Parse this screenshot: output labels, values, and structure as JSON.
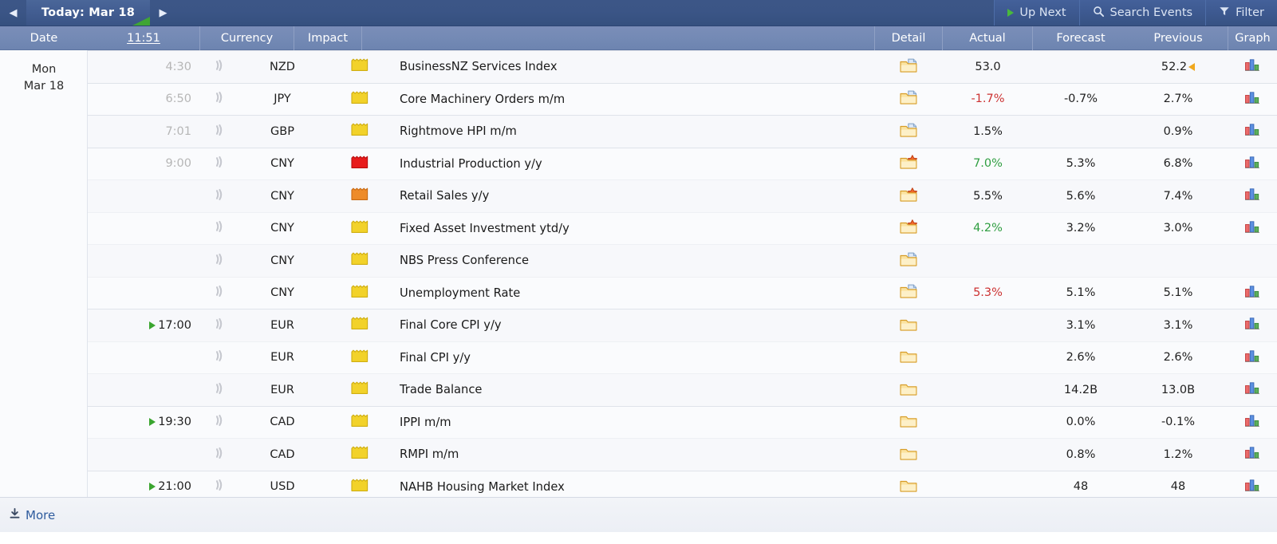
{
  "topbar": {
    "prev_icon": "chevron-left-icon",
    "next_icon": "chevron-right-icon",
    "date_tab": "Today: Mar 18",
    "up_next": "Up Next",
    "search_events": "Search Events",
    "filter": "Filter",
    "accent_green": "#3fa535",
    "bar_color": "#3b5586"
  },
  "columns": {
    "date": "Date",
    "time": "11:51",
    "currency": "Currency",
    "impact": "Impact",
    "event": "",
    "detail": "Detail",
    "actual": "Actual",
    "forecast": "Forecast",
    "previous": "Previous",
    "graph": "Graph"
  },
  "date_group": {
    "weekday": "Mon",
    "monthday": "Mar 18"
  },
  "colors": {
    "better": "#2f9e41",
    "worse": "#cc3232",
    "neutral": "#1f1f1f",
    "revision": "#f0a81e",
    "impact_high": "#e81c1c",
    "impact_medium": "#ee8b29",
    "impact_low": "#f2d22a"
  },
  "rows": [
    {
      "time": "4:30",
      "time_state": "past",
      "show_time": true,
      "group_start": true,
      "alarm": "alarm-icon",
      "currency": "NZD",
      "impact": "low",
      "event": "BusinessNZ Services Index",
      "detail": "folder-doc-icon",
      "actual": "53.0",
      "actual_state": "neutral",
      "forecast": "",
      "previous": "52.2",
      "previous_revised": true,
      "graph": "bar-chart-icon"
    },
    {
      "time": "6:50",
      "time_state": "past",
      "show_time": true,
      "group_start": true,
      "alarm": "alarm-icon",
      "currency": "JPY",
      "impact": "low",
      "event": "Core Machinery Orders m/m",
      "detail": "folder-doc-icon",
      "actual": "-1.7%",
      "actual_state": "worse",
      "forecast": "-0.7%",
      "previous": "2.7%",
      "previous_revised": false,
      "graph": "bar-chart-icon"
    },
    {
      "time": "7:01",
      "time_state": "past",
      "show_time": true,
      "group_start": true,
      "alarm": "alarm-icon",
      "currency": "GBP",
      "impact": "low",
      "event": "Rightmove HPI m/m",
      "detail": "folder-doc-icon",
      "actual": "1.5%",
      "actual_state": "neutral",
      "forecast": "",
      "previous": "0.9%",
      "previous_revised": false,
      "graph": "bar-chart-icon"
    },
    {
      "time": "9:00",
      "time_state": "past",
      "show_time": true,
      "group_start": true,
      "alarm": "alarm-icon",
      "currency": "CNY",
      "impact": "high",
      "event": "Industrial Production y/y",
      "detail": "folder-star-icon",
      "actual": "7.0%",
      "actual_state": "better",
      "forecast": "5.3%",
      "previous": "6.8%",
      "previous_revised": false,
      "graph": "bar-chart-icon"
    },
    {
      "time": "",
      "time_state": "past",
      "show_time": false,
      "group_start": false,
      "alarm": "alarm-icon",
      "currency": "CNY",
      "impact": "medium",
      "event": "Retail Sales y/y",
      "detail": "folder-star-icon",
      "actual": "5.5%",
      "actual_state": "neutral",
      "forecast": "5.6%",
      "previous": "7.4%",
      "previous_revised": false,
      "graph": "bar-chart-icon"
    },
    {
      "time": "",
      "time_state": "past",
      "show_time": false,
      "group_start": false,
      "alarm": "alarm-icon",
      "currency": "CNY",
      "impact": "low",
      "event": "Fixed Asset Investment ytd/y",
      "detail": "folder-star-icon",
      "actual": "4.2%",
      "actual_state": "better",
      "forecast": "3.2%",
      "previous": "3.0%",
      "previous_revised": false,
      "graph": "bar-chart-icon"
    },
    {
      "time": "",
      "time_state": "past",
      "show_time": false,
      "group_start": false,
      "alarm": "alarm-icon",
      "currency": "CNY",
      "impact": "low",
      "event": "NBS Press Conference",
      "detail": "folder-doc-icon",
      "actual": "",
      "actual_state": "neutral",
      "forecast": "",
      "previous": "",
      "previous_revised": false,
      "graph": ""
    },
    {
      "time": "",
      "time_state": "past",
      "show_time": false,
      "group_start": false,
      "alarm": "alarm-icon",
      "currency": "CNY",
      "impact": "low",
      "event": "Unemployment Rate",
      "detail": "folder-doc-icon",
      "actual": "5.3%",
      "actual_state": "worse",
      "forecast": "5.1%",
      "previous": "5.1%",
      "previous_revised": false,
      "graph": "bar-chart-icon"
    },
    {
      "time": "17:00",
      "time_state": "upcoming",
      "show_time": true,
      "group_start": true,
      "alarm": "alarm-icon",
      "currency": "EUR",
      "impact": "low",
      "event": "Final Core CPI y/y",
      "detail": "folder-icon",
      "actual": "",
      "actual_state": "neutral",
      "forecast": "3.1%",
      "previous": "3.1%",
      "previous_revised": false,
      "graph": "bar-chart-icon"
    },
    {
      "time": "",
      "time_state": "upcoming",
      "show_time": false,
      "group_start": false,
      "alarm": "alarm-icon",
      "currency": "EUR",
      "impact": "low",
      "event": "Final CPI y/y",
      "detail": "folder-icon",
      "actual": "",
      "actual_state": "neutral",
      "forecast": "2.6%",
      "previous": "2.6%",
      "previous_revised": false,
      "graph": "bar-chart-icon"
    },
    {
      "time": "",
      "time_state": "upcoming",
      "show_time": false,
      "group_start": false,
      "alarm": "alarm-icon",
      "currency": "EUR",
      "impact": "low",
      "event": "Trade Balance",
      "detail": "folder-icon",
      "actual": "",
      "actual_state": "neutral",
      "forecast": "14.2B",
      "previous": "13.0B",
      "previous_revised": false,
      "graph": "bar-chart-icon"
    },
    {
      "time": "19:30",
      "time_state": "upcoming",
      "show_time": true,
      "group_start": true,
      "alarm": "alarm-icon",
      "currency": "CAD",
      "impact": "low",
      "event": "IPPI m/m",
      "detail": "folder-icon",
      "actual": "",
      "actual_state": "neutral",
      "forecast": "0.0%",
      "previous": "-0.1%",
      "previous_revised": false,
      "graph": "bar-chart-icon"
    },
    {
      "time": "",
      "time_state": "upcoming",
      "show_time": false,
      "group_start": false,
      "alarm": "alarm-icon",
      "currency": "CAD",
      "impact": "low",
      "event": "RMPI m/m",
      "detail": "folder-icon",
      "actual": "",
      "actual_state": "neutral",
      "forecast": "0.8%",
      "previous": "1.2%",
      "previous_revised": false,
      "graph": "bar-chart-icon"
    },
    {
      "time": "21:00",
      "time_state": "upcoming",
      "show_time": true,
      "group_start": true,
      "alarm": "alarm-icon",
      "currency": "USD",
      "impact": "low",
      "event": "NAHB Housing Market Index",
      "detail": "folder-icon",
      "actual": "",
      "actual_state": "neutral",
      "forecast": "48",
      "previous": "48",
      "previous_revised": false,
      "graph": "bar-chart-icon"
    }
  ],
  "footer": {
    "more": "More",
    "more_icon": "download-arrow-icon"
  }
}
